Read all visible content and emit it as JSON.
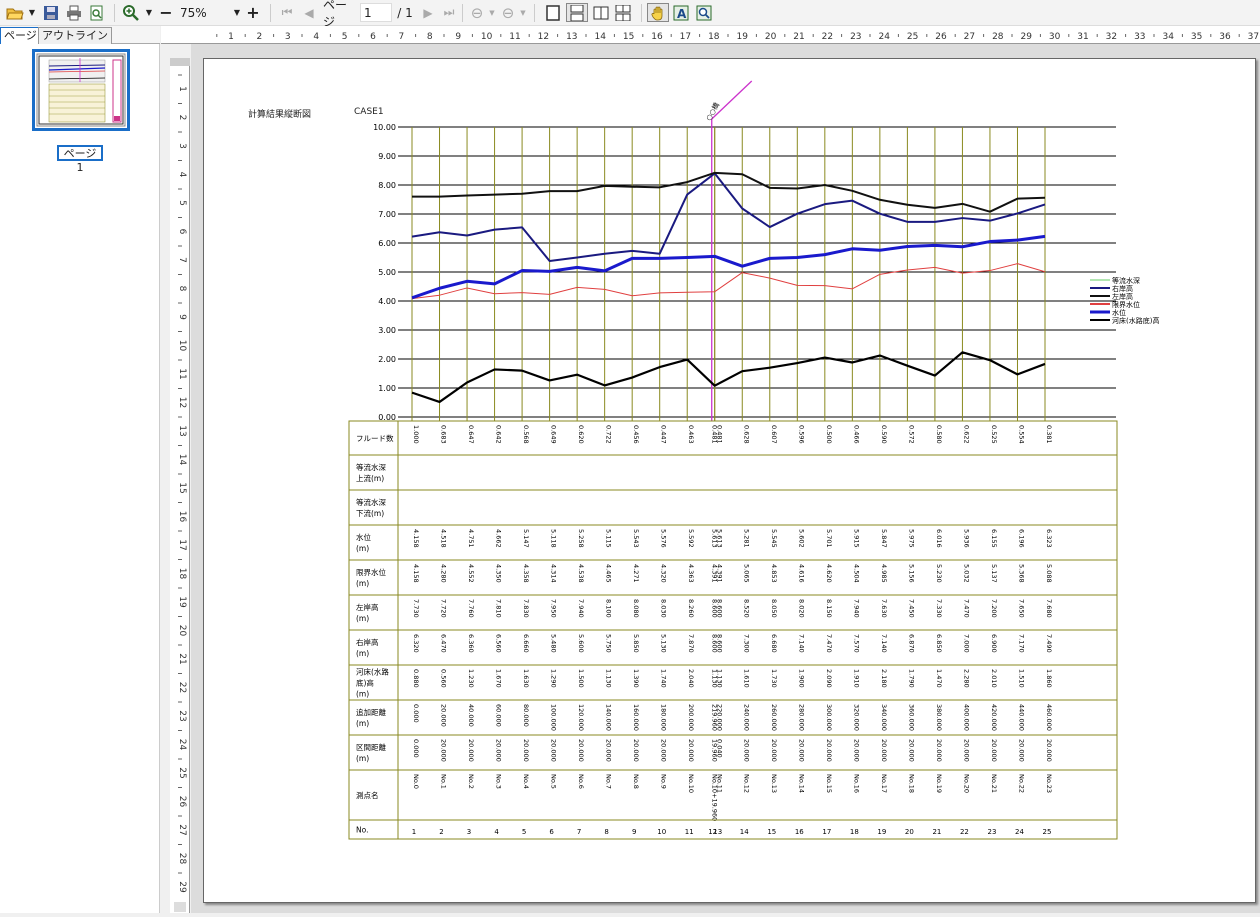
{
  "toolbar": {
    "zoom": "75%",
    "page_label": "ページ",
    "page_current": "1",
    "page_total": "/ 1"
  },
  "tabs": [
    {
      "label": "ページ"
    },
    {
      "label": "アウトライン"
    }
  ],
  "thumbnail": {
    "caption": "ページ 1"
  },
  "ruler_h_ticks": [
    "1",
    "2",
    "3",
    "4",
    "5",
    "6",
    "7",
    "8",
    "9",
    "10",
    "11",
    "12",
    "13",
    "14",
    "15",
    "16",
    "17",
    "18",
    "19",
    "20",
    "21",
    "22",
    "23",
    "24",
    "25",
    "26",
    "27",
    "28",
    "29",
    "30",
    "31",
    "32",
    "33",
    "34",
    "35",
    "36",
    "37"
  ],
  "ruler_v_ticks": [
    "1",
    "2",
    "3",
    "4",
    "5",
    "6",
    "7",
    "8",
    "9",
    "10",
    "11",
    "12",
    "13",
    "14",
    "15",
    "16",
    "17",
    "18",
    "19",
    "20",
    "21",
    "22",
    "23",
    "24",
    "25",
    "26",
    "27",
    "28",
    "29"
  ],
  "report": {
    "title": "計算結果縦断図",
    "case": "CASE1"
  },
  "chart_data": {
    "type": "line",
    "ylim": [
      0,
      10
    ],
    "yticks": [
      "10.00",
      "9.00",
      "8.00",
      "7.00",
      "6.00",
      "5.00",
      "4.00",
      "3.00",
      "2.00",
      "1.00",
      "0.00"
    ],
    "x": [
      0,
      20,
      40,
      60,
      80,
      100,
      120,
      140,
      160,
      180,
      200,
      219.96,
      220,
      240,
      260,
      280,
      300,
      320,
      340,
      360,
      380,
      400,
      420,
      440,
      460
    ],
    "marker_label": "○○橋",
    "legend": [
      "等流水深",
      "右岸高",
      "左岸高",
      "限界水位",
      "水位",
      "河床(水路底)高"
    ],
    "colors": {
      "等流水深": "#66cc66",
      "右岸高": "#1a1a80",
      "左岸高": "#111111",
      "限界水位": "#e04040",
      "水位": "#1a1acc",
      "河床(水路底)高": "#000000",
      "marker": "#cc33cc"
    },
    "series": [
      {
        "name": "右岸高",
        "values": [
          6.22,
          6.37,
          6.26,
          6.46,
          6.54,
          5.38,
          5.5,
          5.63,
          5.73,
          5.63,
          7.67,
          8.4,
          8.4,
          7.19,
          6.55,
          7.01,
          7.34,
          7.46,
          7.01,
          6.73,
          6.73,
          6.86,
          6.77,
          7.02,
          7.33
        ]
      },
      {
        "name": "左岸高",
        "values": [
          7.6,
          7.6,
          7.64,
          7.67,
          7.7,
          7.79,
          7.79,
          7.97,
          7.94,
          7.92,
          8.1,
          8.42,
          8.42,
          8.37,
          7.9,
          7.88,
          8.0,
          7.8,
          7.49,
          7.32,
          7.21,
          7.35,
          7.08,
          7.53,
          7.56
        ]
      },
      {
        "name": "限界水位",
        "values": [
          4.08,
          4.2,
          4.45,
          4.25,
          4.29,
          4.23,
          4.47,
          4.4,
          4.18,
          4.28,
          4.3,
          4.32,
          4.32,
          4.98,
          4.79,
          4.54,
          4.53,
          4.42,
          4.92,
          5.07,
          5.16,
          4.96,
          5.05,
          5.29,
          5.01
        ]
      },
      {
        "name": "水位",
        "values": [
          4.11,
          4.44,
          4.68,
          4.59,
          5.05,
          5.02,
          5.16,
          5.04,
          5.47,
          5.47,
          5.5,
          5.54,
          5.54,
          5.2,
          5.47,
          5.5,
          5.6,
          5.8,
          5.75,
          5.88,
          5.92,
          5.87,
          6.05,
          6.1,
          6.23
        ]
      },
      {
        "name": "河床(水路底)高",
        "values": [
          0.84,
          0.52,
          1.19,
          1.64,
          1.6,
          1.26,
          1.46,
          1.09,
          1.36,
          1.72,
          1.98,
          1.08,
          1.08,
          1.58,
          1.7,
          1.86,
          2.05,
          1.88,
          2.12,
          1.77,
          1.43,
          2.23,
          1.96,
          1.47,
          1.83
        ]
      }
    ]
  },
  "table": {
    "row_labels": [
      [
        "フルード数"
      ],
      [
        "等流水深",
        "上流(m)"
      ],
      [
        "等流水深",
        "下流(m)"
      ],
      [
        "水位",
        "(m)"
      ],
      [
        "限界水位",
        "(m)"
      ],
      [
        "左岸高",
        "(m)"
      ],
      [
        "右岸高",
        "(m)"
      ],
      [
        "河床(水路",
        "底)高",
        "(m)"
      ],
      [
        "追加距離",
        "(m)"
      ],
      [
        "区間距離",
        "(m)"
      ],
      [
        "測点名"
      ],
      [
        "No."
      ]
    ],
    "froude": [
      "1.000",
      "0.683",
      "0.647",
      "0.642",
      "0.568",
      "0.649",
      "0.620",
      "0.722",
      "0.456",
      "0.447",
      "0.463",
      "0.481",
      "0.481",
      "0.628",
      "0.607",
      "0.596",
      "0.500",
      "0.466",
      "0.590",
      "0.572",
      "0.580",
      "0.622",
      "0.525",
      "0.554",
      "0.381"
    ],
    "wl": [
      "4.158",
      "4.518",
      "4.751",
      "4.662",
      "5.147",
      "5.118",
      "5.258",
      "5.115",
      "5.543",
      "5.576",
      "5.592",
      "5.613",
      "5.613",
      "5.281",
      "5.545",
      "5.602",
      "5.701",
      "5.915",
      "5.847",
      "5.975",
      "6.016",
      "5.936",
      "6.155",
      "6.196",
      "6.323"
    ],
    "cwl": [
      "4.158",
      "4.280",
      "4.552",
      "4.350",
      "4.358",
      "4.314",
      "4.538",
      "4.465",
      "4.271",
      "4.320",
      "4.363",
      "4.391",
      "4.391",
      "5.065",
      "4.853",
      "4.616",
      "4.620",
      "4.504",
      "4.985",
      "5.156",
      "5.230",
      "5.032",
      "5.137",
      "5.368",
      "5.088"
    ],
    "left": [
      "7.730",
      "7.720",
      "7.760",
      "7.810",
      "7.830",
      "7.950",
      "7.940",
      "8.100",
      "8.080",
      "8.030",
      "8.260",
      "8.600",
      "8.600",
      "8.520",
      "8.050",
      "8.020",
      "8.150",
      "7.940",
      "7.630",
      "7.450",
      "7.330",
      "7.470",
      "7.200",
      "7.650",
      "7.680"
    ],
    "right": [
      "6.320",
      "6.470",
      "6.360",
      "6.560",
      "6.660",
      "5.480",
      "5.600",
      "5.750",
      "5.850",
      "5.130",
      "7.870",
      "8.600",
      "8.600",
      "7.300",
      "6.680",
      "7.140",
      "7.470",
      "7.570",
      "7.140",
      "6.870",
      "6.850",
      "7.000",
      "6.900",
      "7.170",
      "7.490"
    ],
    "bed": [
      "0.880",
      "0.560",
      "1.230",
      "1.670",
      "1.630",
      "1.290",
      "1.500",
      "1.130",
      "1.390",
      "1.740",
      "2.040",
      "1.130",
      "1.130",
      "1.610",
      "1.730",
      "1.900",
      "2.090",
      "1.910",
      "2.180",
      "1.790",
      "1.470",
      "2.280",
      "2.010",
      "1.510",
      "1.860"
    ],
    "cum": [
      "0.000",
      "20.000",
      "40.000",
      "60.000",
      "80.000",
      "100.000",
      "120.000",
      "140.000",
      "160.000",
      "180.000",
      "200.000",
      "219.960",
      "220.000",
      "240.000",
      "260.000",
      "280.000",
      "300.000",
      "320.000",
      "340.000",
      "360.000",
      "380.000",
      "400.000",
      "420.000",
      "440.000",
      "460.000"
    ],
    "seg": [
      "0.000",
      "20.000",
      "20.000",
      "20.000",
      "20.000",
      "20.000",
      "20.000",
      "20.000",
      "20.000",
      "20.000",
      "20.000",
      "19.960",
      "0.040",
      "20.000",
      "20.000",
      "20.000",
      "20.000",
      "20.000",
      "20.000",
      "20.000",
      "20.000",
      "20.000",
      "20.000",
      "20.000",
      "20.000"
    ],
    "station": [
      "No.0",
      "No.1",
      "No.2",
      "No.3",
      "No.4",
      "No.5",
      "No.6",
      "No.7",
      "No.8",
      "No.9",
      "No.10",
      "No.10+19.960",
      "No.11",
      "No.12",
      "No.13",
      "No.14",
      "No.15",
      "No.16",
      "No.17",
      "No.18",
      "No.19",
      "No.20",
      "No.21",
      "No.22",
      "No.23"
    ],
    "no": [
      "1",
      "2",
      "3",
      "4",
      "5",
      "6",
      "7",
      "8",
      "9",
      "10",
      "11",
      "12",
      "13",
      "14",
      "15",
      "16",
      "17",
      "18",
      "19",
      "20",
      "21",
      "22",
      "23",
      "24",
      "25"
    ]
  }
}
